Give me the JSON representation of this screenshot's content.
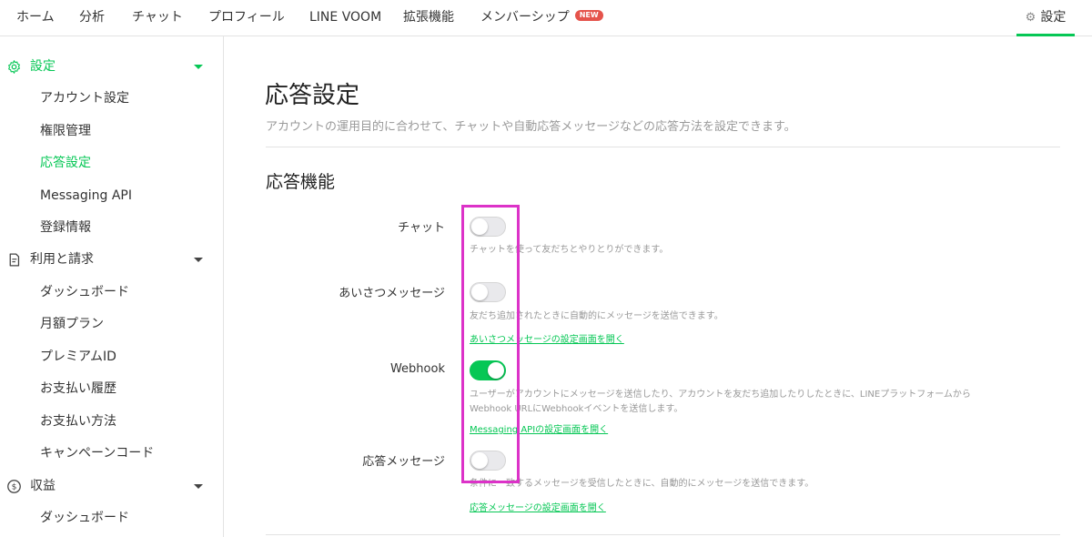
{
  "topnav": {
    "items": [
      "ホーム",
      "分析",
      "チャット",
      "プロフィール",
      "LINE VOOM",
      "拡張機能",
      "メンバーシップ"
    ],
    "new_badge": "NEW",
    "settings_label": "設定"
  },
  "sidebar": {
    "sections": [
      {
        "label": "設定",
        "icon": "gear-icon",
        "items": [
          "アカウント設定",
          "権限管理",
          "応答設定",
          "Messaging API",
          "登録情報"
        ]
      },
      {
        "label": "利用と請求",
        "icon": "document-icon",
        "items": [
          "ダッシュボード",
          "月額プラン",
          "プレミアムID",
          "お支払い履歴",
          "お支払い方法",
          "キャンペーンコード"
        ]
      },
      {
        "label": "収益",
        "icon": "dollar-icon",
        "items": [
          "ダッシュボード"
        ]
      }
    ],
    "active_item": "応答設定"
  },
  "main": {
    "title": "応答設定",
    "description": "アカウントの運用目的に合わせて、チャットや自動応答メッセージなどの応答方法を設定できます。",
    "section_title": "応答機能",
    "rows": [
      {
        "label": "チャット",
        "enabled": false,
        "desc": [
          "チャットを使って友だちとやりとりができます。"
        ],
        "link": ""
      },
      {
        "label": "あいさつメッセージ",
        "enabled": false,
        "desc": [
          "友だち追加されたときに自動的にメッセージを送信できます。"
        ],
        "link": "あいさつメッセージの設定画面を開く"
      },
      {
        "label": "Webhook",
        "enabled": true,
        "desc": [
          "ユーザーがアカウントにメッセージを送信したり、アカウントを友だち追加したりしたときに、LINEプラットフォームから",
          "Webhook URLにWebhookイベントを送信します。"
        ],
        "link": "Messaging APIの設定画面を開く"
      },
      {
        "label": "応答メッセージ",
        "enabled": false,
        "desc": [
          "条件に一致するメッセージを受信したときに、自動的にメッセージを送信できます。"
        ],
        "link": "応答メッセージの設定画面を開く"
      }
    ]
  },
  "colors": {
    "accent": "#06c755",
    "highlight": "#dc32c8",
    "new_badge": "#e5534b"
  }
}
